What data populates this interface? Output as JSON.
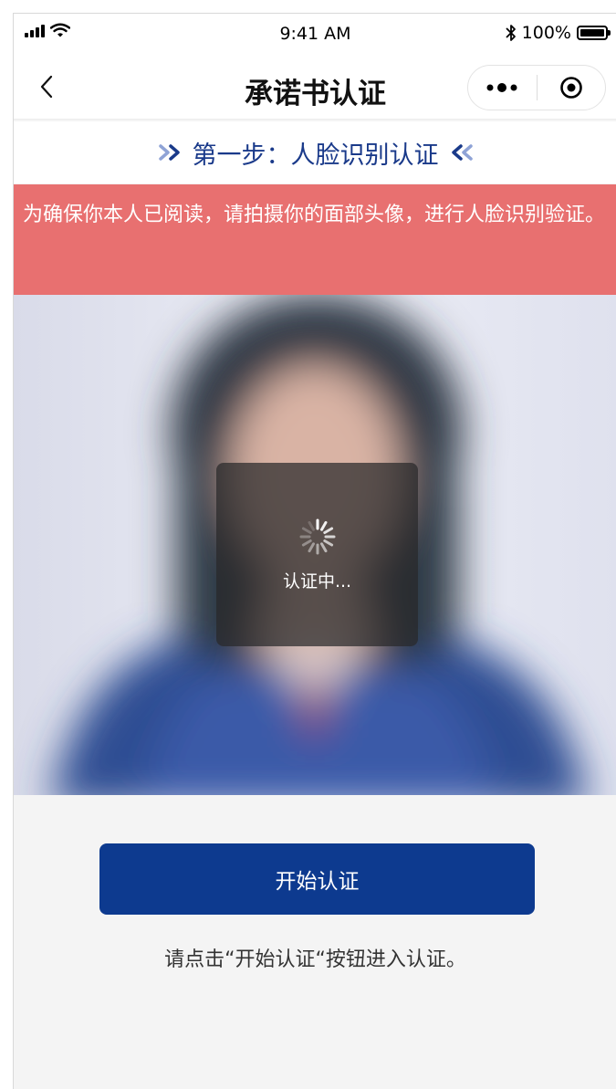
{
  "status_bar": {
    "time": "9:41 AM",
    "battery": "100%",
    "icons": [
      "signal-icon",
      "wifi-icon",
      "bluetooth-icon",
      "battery-icon"
    ]
  },
  "nav": {
    "title": "承诺书认证",
    "back_icon": "chevron-left-icon",
    "more_icon": "more-dots-icon",
    "close_icon": "record-circle-icon"
  },
  "step": {
    "label": "第一步：人脸识别认证",
    "left_icon": "double-chevron-right-icon",
    "right_icon": "double-chevron-left-icon"
  },
  "notice": {
    "text": "为确保你本人已阅读，请拍摄你的面部头像，进行人脸识别验证。",
    "background": "#e87070"
  },
  "loading": {
    "text": "认证中...",
    "icon": "spinner-icon"
  },
  "actions": {
    "start_label": "开始认证",
    "hint": "请点击“开始认证“按钮进入认证。"
  },
  "colors": {
    "primary": "#0d3a8f",
    "step_text": "#1a3a8a",
    "notice_bg": "#e87070"
  }
}
